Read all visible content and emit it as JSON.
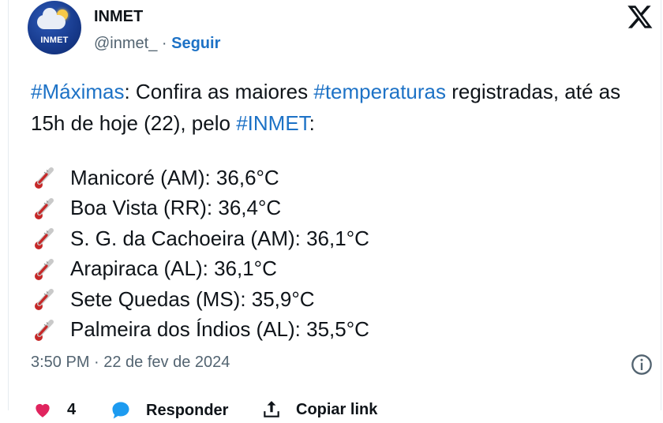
{
  "account": {
    "avatar_label": "INMET",
    "name": "INMET",
    "handle": "@inmet_",
    "separator": " · ",
    "follow_label": "Seguir"
  },
  "tweet": {
    "intro": [
      {
        "text": "#Máximas",
        "tag": true
      },
      {
        "text": ": Confira as maiores ",
        "tag": false
      },
      {
        "text": "#temperaturas",
        "tag": true
      },
      {
        "text": " registradas, até as 15h de hoje (22), pelo ",
        "tag": false
      },
      {
        "text": "#INMET",
        "tag": true
      },
      {
        "text": ":",
        "tag": false
      }
    ],
    "items": [
      {
        "icon": "thermometer-icon",
        "text": "Manicoré (AM): 36,6°C"
      },
      {
        "icon": "thermometer-icon",
        "text": "Boa Vista (RR): 36,4°C"
      },
      {
        "icon": "thermometer-icon",
        "text": "S. G. da Cachoeira (AM): 36,1°C"
      },
      {
        "icon": "thermometer-icon",
        "text": "Arapiraca (AL): 36,1°C"
      },
      {
        "icon": "thermometer-icon",
        "text": "Sete Quedas (MS): 35,9°C"
      },
      {
        "icon": "thermometer-icon",
        "text": "Palmeira dos Índios (AL): 35,5°C"
      }
    ]
  },
  "meta": {
    "timestamp": "3:50 PM · 22 de fev de 2024"
  },
  "actions": {
    "like_count": "4",
    "reply_label": "Responder",
    "share_label": "Copiar link"
  },
  "colors": {
    "link": "#1d72c6",
    "text": "#0f1419",
    "muted": "#536471",
    "brand_blue": "#173a8c",
    "like": "#e0245e",
    "reply": "#1d9bf0"
  }
}
